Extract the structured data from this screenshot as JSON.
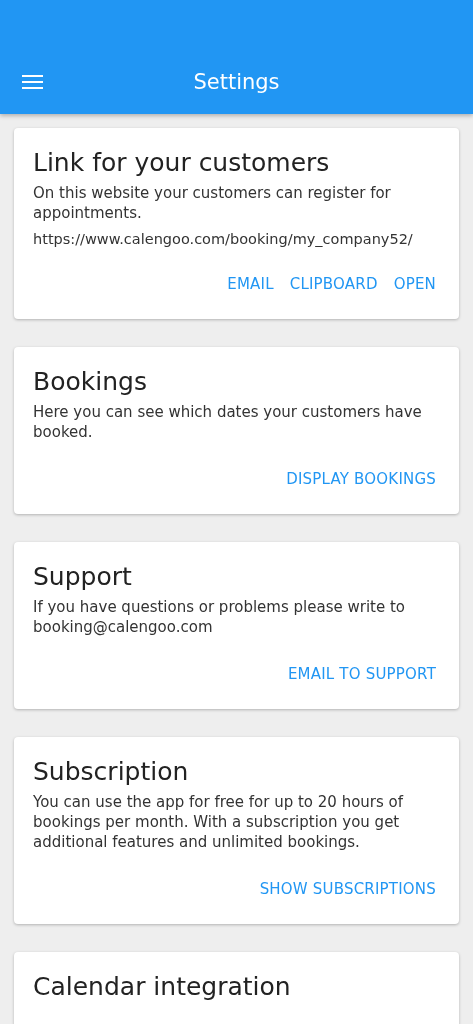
{
  "app_bar": {
    "title": "Settings"
  },
  "cards": [
    {
      "title": "Link for your customers",
      "text": "On this website your customers can register for appointments.",
      "link": "https://www.calengoo.com/booking/my_company52/",
      "actions": [
        "EMAIL",
        "CLIPBOARD",
        "OPEN"
      ]
    },
    {
      "title": "Bookings",
      "text": "Here you can see which dates your customers have booked.",
      "actions": [
        "DISPLAY BOOKINGS"
      ]
    },
    {
      "title": "Support",
      "text": "If you have questions or problems please write to booking@calengoo.com",
      "actions": [
        "EMAIL TO SUPPORT"
      ]
    },
    {
      "title": "Subscription",
      "text": "You can use the app for free for up to 20 hours of bookings per month. With a subscription you get additional features and unlimited bookings.",
      "actions": [
        "SHOW SUBSCRIPTIONS"
      ]
    },
    {
      "title": "Calendar integration"
    }
  ]
}
